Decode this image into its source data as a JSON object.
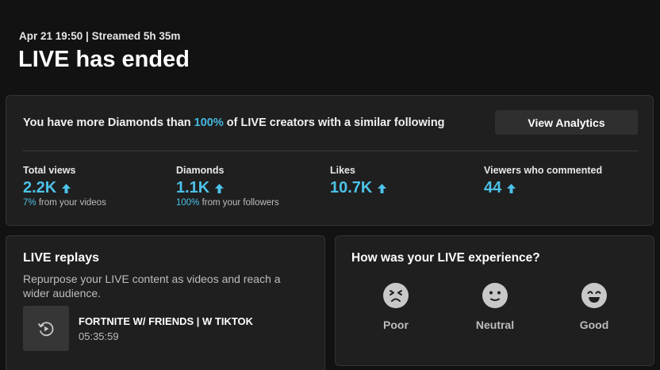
{
  "header": {
    "meta": "Apr 21 19:50 | Streamed 5h 35m",
    "title": "LIVE has ended"
  },
  "summary": {
    "diamond_prefix": "You have more Diamonds than ",
    "diamond_pct": "100%",
    "diamond_suffix": " of LIVE creators with a similar following",
    "analytics_button": "View Analytics",
    "stats": [
      {
        "label": "Total views",
        "value": "2.2K",
        "sub_pct": "7%",
        "sub_text": " from your videos"
      },
      {
        "label": "Diamonds",
        "value": "1.1K",
        "sub_pct": "100%",
        "sub_text": " from your followers"
      },
      {
        "label": "Likes",
        "value": "10.7K",
        "sub_pct": "",
        "sub_text": ""
      },
      {
        "label": "Viewers who commented",
        "value": "44",
        "sub_pct": "",
        "sub_text": ""
      }
    ],
    "arrow_icon": "arrow-up-icon"
  },
  "replays": {
    "title": "LIVE replays",
    "description": "Repurpose your LIVE content as videos and reach a wider audience.",
    "video": {
      "title": "FORTNITE W/ FRIENDS | W TIKTOK",
      "duration": "05:35:59",
      "icon": "replay-icon"
    }
  },
  "experience": {
    "title": "How was your LIVE experience?",
    "options": [
      {
        "label": "Poor",
        "icon": "face-poor-icon"
      },
      {
        "label": "Neutral",
        "icon": "face-neutral-icon"
      },
      {
        "label": "Good",
        "icon": "face-good-icon"
      }
    ]
  },
  "colors": {
    "accent": "#4cc2e8",
    "background": "#121212",
    "panel": "#1f1f1f",
    "face": "#c8c8c8"
  }
}
